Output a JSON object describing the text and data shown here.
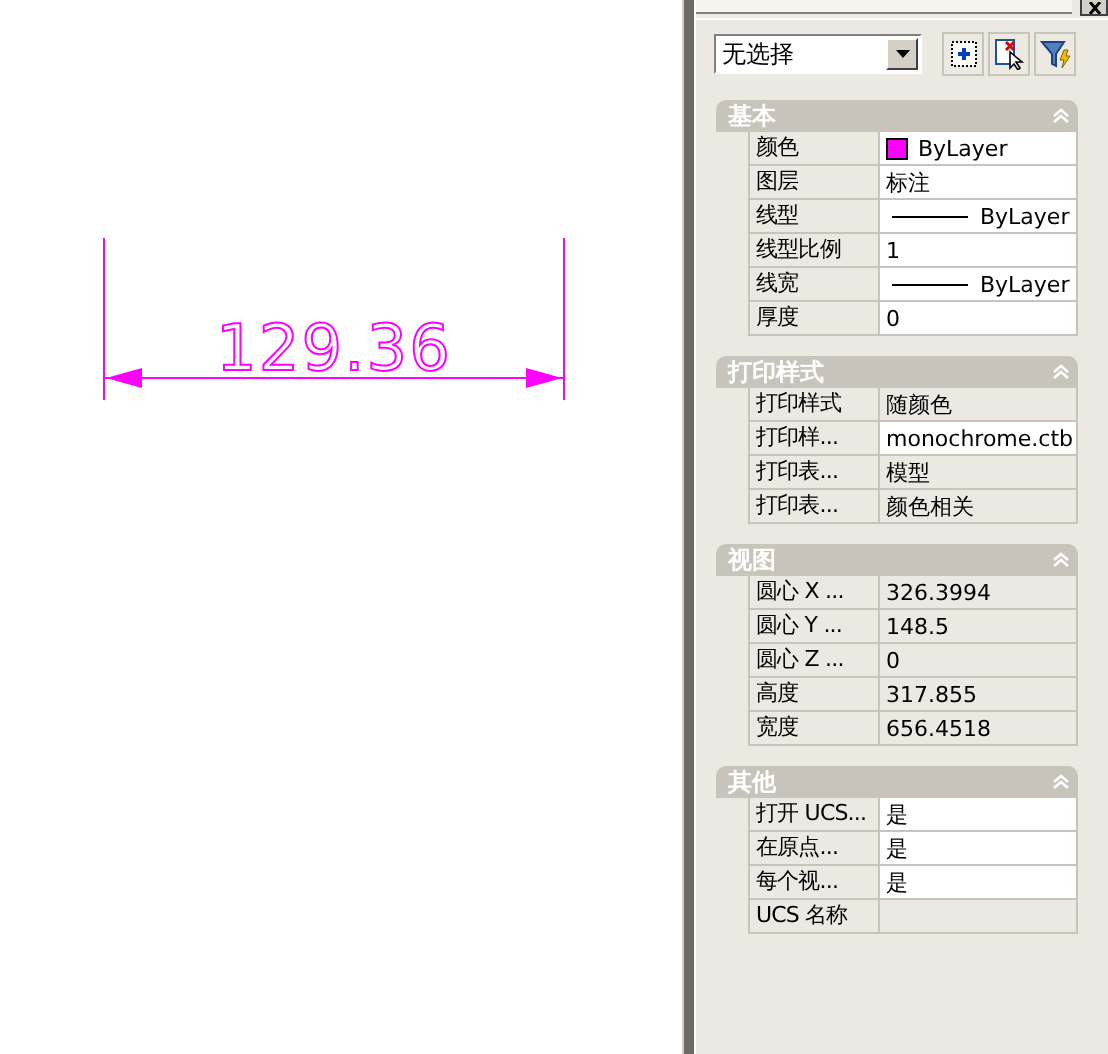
{
  "drawing": {
    "dimension_text": "129.36"
  },
  "selector": {
    "value": "无选择"
  },
  "sections": [
    {
      "title": "基本",
      "expanded": true,
      "rows": [
        {
          "label": "颜色",
          "value": "ByLayer",
          "kind": "color",
          "color": "#ff00ff",
          "readonly": false
        },
        {
          "label": "图层",
          "value": "标注",
          "kind": "text",
          "readonly": false
        },
        {
          "label": "线型",
          "value": "ByLayer",
          "kind": "line",
          "readonly": false
        },
        {
          "label": "线型比例",
          "value": "1",
          "kind": "text",
          "readonly": false
        },
        {
          "label": "线宽",
          "value": "ByLayer",
          "kind": "line",
          "readonly": false
        },
        {
          "label": "厚度",
          "value": "0",
          "kind": "text",
          "readonly": false
        }
      ]
    },
    {
      "title": "打印样式",
      "expanded": true,
      "rows": [
        {
          "label": "打印样式",
          "value": "随颜色",
          "kind": "text",
          "readonly": true
        },
        {
          "label": "打印样...",
          "value": "monochrome.ctb",
          "kind": "text",
          "readonly": false
        },
        {
          "label": "打印表...",
          "value": "模型",
          "kind": "text",
          "readonly": true
        },
        {
          "label": "打印表...",
          "value": "颜色相关",
          "kind": "text",
          "readonly": true
        }
      ]
    },
    {
      "title": "视图",
      "expanded": true,
      "rows": [
        {
          "label": "圆心 X ...",
          "value": "326.3994",
          "kind": "text",
          "readonly": true
        },
        {
          "label": "圆心 Y ...",
          "value": "148.5",
          "kind": "text",
          "readonly": true
        },
        {
          "label": "圆心 Z ...",
          "value": "0",
          "kind": "text",
          "readonly": true
        },
        {
          "label": "高度",
          "value": "317.855",
          "kind": "text",
          "readonly": true
        },
        {
          "label": "宽度",
          "value": "656.4518",
          "kind": "text",
          "readonly": true
        }
      ]
    },
    {
      "title": "其他",
      "expanded": true,
      "rows": [
        {
          "label": "打开 UCS...",
          "value": "是",
          "kind": "text",
          "readonly": false
        },
        {
          "label": "在原点...",
          "value": "是",
          "kind": "text",
          "readonly": false
        },
        {
          "label": "每个视...",
          "value": "是",
          "kind": "text",
          "readonly": false
        },
        {
          "label": "UCS 名称",
          "kind": "text",
          "readonly": true
        }
      ]
    }
  ]
}
